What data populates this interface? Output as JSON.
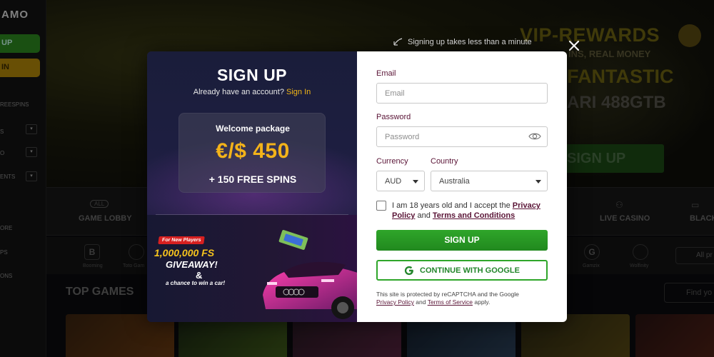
{
  "background": {
    "brand_partial": "AMO",
    "sidebar_buttons": [
      "UP",
      "IN"
    ],
    "sidebar_items": [
      "REESPINS",
      "S",
      "O",
      "ENTS",
      "ORE",
      "PS",
      "ONS"
    ],
    "hero": {
      "vip_title": "VIP-REWARDS",
      "vip_sub": "INS, REAL MONEY",
      "line_1": "FANTASTIC",
      "line_2": "ARI 488GTB",
      "cta": "SIGN UP"
    },
    "tabs": [
      {
        "label": "GAME LOBBY",
        "icon": "ALL"
      },
      {
        "label": "LIVE CASINO",
        "icon": "chips-icon"
      },
      {
        "label": "BLACK",
        "icon": "cards-icon"
      }
    ],
    "filters": [
      {
        "letter": "B",
        "label": "Booming"
      },
      {
        "letter": "",
        "label": "Toto Gam"
      },
      {
        "letter": "G",
        "label": "Gamzix"
      },
      {
        "letter": "",
        "label": "Wolfinity"
      }
    ],
    "all_providers": "All pr",
    "section_title": "TOP GAMES",
    "search_placeholder": "Find yo"
  },
  "hint": "Signing up takes less than a minute",
  "signup": {
    "title": "SIGN UP",
    "have_account": "Already have an account?",
    "sign_in": "Sign In",
    "welcome": {
      "title": "Welcome package",
      "amount": "€/$ 450",
      "spins": "+ 150 FREE SPINS"
    },
    "promo": {
      "badge": "For New Players",
      "headline": "1,000,000 FS",
      "giveaway": "GIVEAWAY!",
      "amp": "&",
      "subline": "a chance to win a car!"
    }
  },
  "form": {
    "email_label": "Email",
    "email_placeholder": "Email",
    "password_label": "Password",
    "password_placeholder": "Password",
    "currency_label": "Currency",
    "currency_value": "AUD",
    "country_label": "Country",
    "country_value": "Australia",
    "agree_prefix": "I am 18 years old and I accept the",
    "privacy_policy": "Privacy Policy",
    "and": "and",
    "terms": "Terms and Conditions",
    "signup_button": "SIGN UP",
    "google_button": "CONTINUE WITH GOOGLE",
    "recaptcha_text": "This site is protected by reCAPTCHA and the Google",
    "recaptcha_privacy": "Privacy Policy",
    "recaptcha_and": "and",
    "recaptcha_terms": "Terms of Service",
    "recaptcha_apply": "apply."
  },
  "colors": {
    "accent_green": "#2fa62a",
    "accent_gold": "#f3b31a",
    "label_maroon": "#5a1436"
  }
}
